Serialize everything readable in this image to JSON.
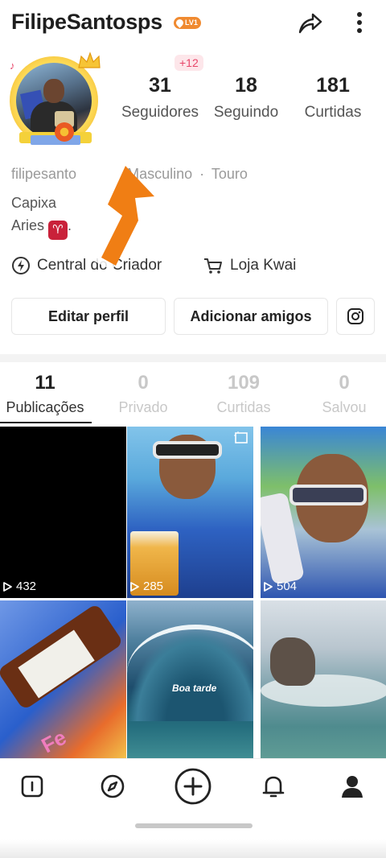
{
  "header": {
    "username": "FilipeSantosps",
    "level_badge": "LV1"
  },
  "stats": {
    "new_followers_badge": "+12",
    "followers": {
      "value": "31",
      "label": "Seguidores"
    },
    "following": {
      "value": "18",
      "label": "Seguindo"
    },
    "likes": {
      "value": "181",
      "label": "Curtidas"
    }
  },
  "profile": {
    "handle": "filipesanto",
    "gender": "Masculino",
    "separator": "·",
    "zodiac": "Touro",
    "bio_line_1": "Capixa",
    "bio_line_2": "Aries",
    "bio_symbol": "♈"
  },
  "links": {
    "creator_center": "Central do Criador",
    "store": "Loja Kwai"
  },
  "buttons": {
    "edit_profile": "Editar perfil",
    "add_friends": "Adicionar amigos"
  },
  "tabs": [
    {
      "count": "11",
      "label": "Publicações",
      "active": true
    },
    {
      "count": "0",
      "label": "Privado",
      "active": false
    },
    {
      "count": "109",
      "label": "Curtidas",
      "active": false
    },
    {
      "count": "0",
      "label": "Salvou",
      "active": false
    }
  ],
  "posts": [
    {
      "plays": "432"
    },
    {
      "plays": "285"
    },
    {
      "plays": "504"
    },
    {
      "plays": ""
    },
    {
      "plays": "",
      "caption": "Boa tarde"
    },
    {
      "plays": ""
    }
  ],
  "post_overlay_text": "Fe",
  "colors": {
    "accent_orange": "#f08a30",
    "pink_badge": "#e8476a",
    "aries_red": "#c9213a",
    "arrow_orange": "#f07e14"
  },
  "icons": {
    "share": "share-arrow-icon",
    "more": "more-vertical-icon",
    "creator": "lightning-icon",
    "store": "cart-icon",
    "instagram": "instagram-icon",
    "nav": [
      "home-icon",
      "explore-compass-icon",
      "create-plus-icon",
      "notification-bell-icon",
      "profile-icon"
    ]
  }
}
